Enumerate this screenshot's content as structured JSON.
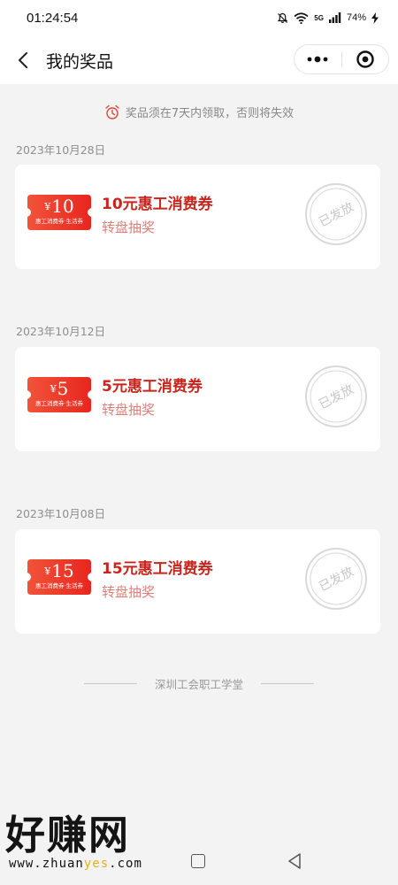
{
  "status_bar": {
    "time": "01:24:54",
    "network": "5G",
    "battery": "74%"
  },
  "header": {
    "title": "我的奖品",
    "back_icon": "chevron-left-icon",
    "more_icon": "more-dots-icon",
    "close_icon": "target-circle-icon"
  },
  "notice": {
    "icon": "alarm-clock-icon",
    "text": "奖品须在7天内领取，否则将失效"
  },
  "prizes": [
    {
      "date": "2023年10月28日",
      "currency": "¥",
      "amount": "10",
      "coupon_sub": "惠工消费券·生活券",
      "name": "10元惠工消费券",
      "source": "转盘抽奖",
      "status": "已发放"
    },
    {
      "date": "2023年10月12日",
      "currency": "¥",
      "amount": "5",
      "coupon_sub": "惠工消费券·生活券",
      "name": "5元惠工消费券",
      "source": "转盘抽奖",
      "status": "已发放"
    },
    {
      "date": "2023年10月08日",
      "currency": "¥",
      "amount": "15",
      "coupon_sub": "惠工消费券·生活券",
      "name": "15元惠工消费券",
      "source": "转盘抽奖",
      "status": "已发放"
    }
  ],
  "footer": {
    "text": "深圳工会职工学堂"
  },
  "watermark": {
    "logo_text": "好赚网",
    "url_prefix": "www.zhuan",
    "url_highlight": "yes",
    "url_suffix": ".com"
  },
  "colors": {
    "prize_name": "#c8251e",
    "prize_source": "#e07e79",
    "coupon_from": "#f2533a",
    "coupon_to": "#e8261e",
    "stamp": "#d9d9d9"
  }
}
